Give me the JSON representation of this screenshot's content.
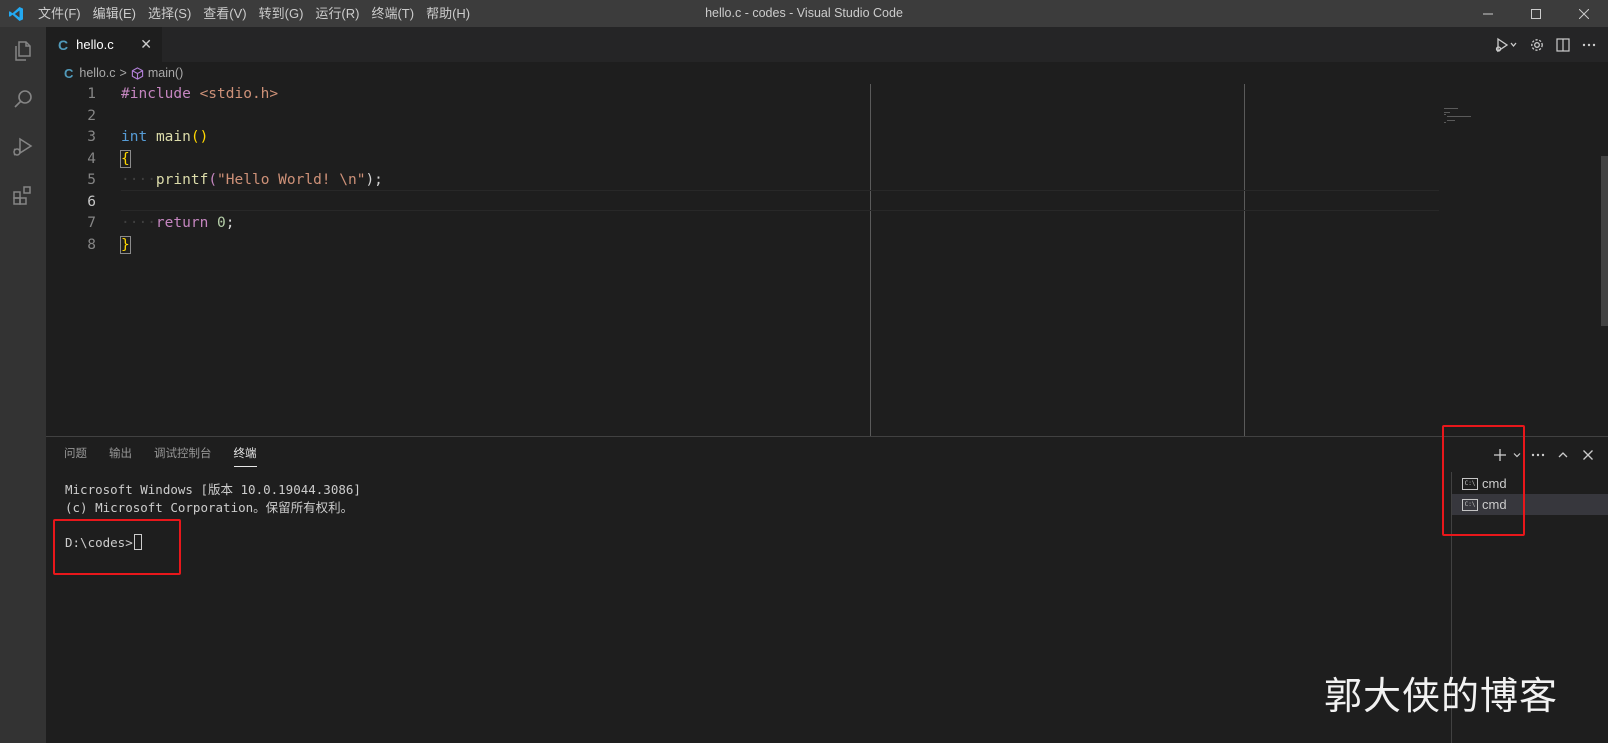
{
  "titlebar": {
    "menu": [
      "文件(F)",
      "编辑(E)",
      "选择(S)",
      "查看(V)",
      "转到(G)",
      "运行(R)",
      "终端(T)",
      "帮助(H)"
    ],
    "window_title": "hello.c - codes - Visual Studio Code"
  },
  "activity_bar": {
    "items": [
      "files-icon",
      "search-icon",
      "run-debug-icon",
      "extensions-icon"
    ]
  },
  "tab": {
    "icon_label": "C",
    "filename": "hello.c",
    "close_glyph": "✕"
  },
  "editor_actions": [
    "run-icon",
    "gear-icon",
    "split-editor-icon",
    "more-icon"
  ],
  "breadcrumbs": {
    "icon_label": "C",
    "file": "hello.c",
    "separator": ">",
    "symbol": "main()"
  },
  "code": {
    "line_numbers": [
      "1",
      "2",
      "3",
      "4",
      "5",
      "6",
      "7",
      "8"
    ],
    "active_line": 6,
    "include_kw": "#include",
    "include_header": "<stdio.h>",
    "int_kw": "int",
    "main_fn": "main",
    "parens": "()",
    "open_brace": "{",
    "printf_fn": "printf",
    "printf_open": "(",
    "printf_str": "\"Hello World! \\n\"",
    "printf_close": ");",
    "return_kw": "return",
    "return_val": "0",
    "semicolon": ";",
    "close_brace": "}",
    "indent_dots": "····"
  },
  "panel": {
    "tabs": [
      "问题",
      "输出",
      "调试控制台",
      "终端"
    ],
    "active_tab": "终端",
    "terminal_lines": [
      "Microsoft Windows [版本 10.0.19044.3086]",
      "(c) Microsoft Corporation。保留所有权利。",
      "",
      "D:\\codes>"
    ],
    "terminal_list": [
      {
        "icon_label": "C:\\",
        "name": "cmd",
        "selected": false
      },
      {
        "icon_label": "C:\\",
        "name": "cmd",
        "selected": true
      }
    ],
    "actions": [
      "plus-icon",
      "chevron-down-icon",
      "more-icon",
      "chevron-up-icon",
      "close-icon"
    ]
  },
  "watermark": "郭大侠的博客",
  "colors": {
    "highlight": "#e8171b",
    "accent": "#007acc"
  }
}
